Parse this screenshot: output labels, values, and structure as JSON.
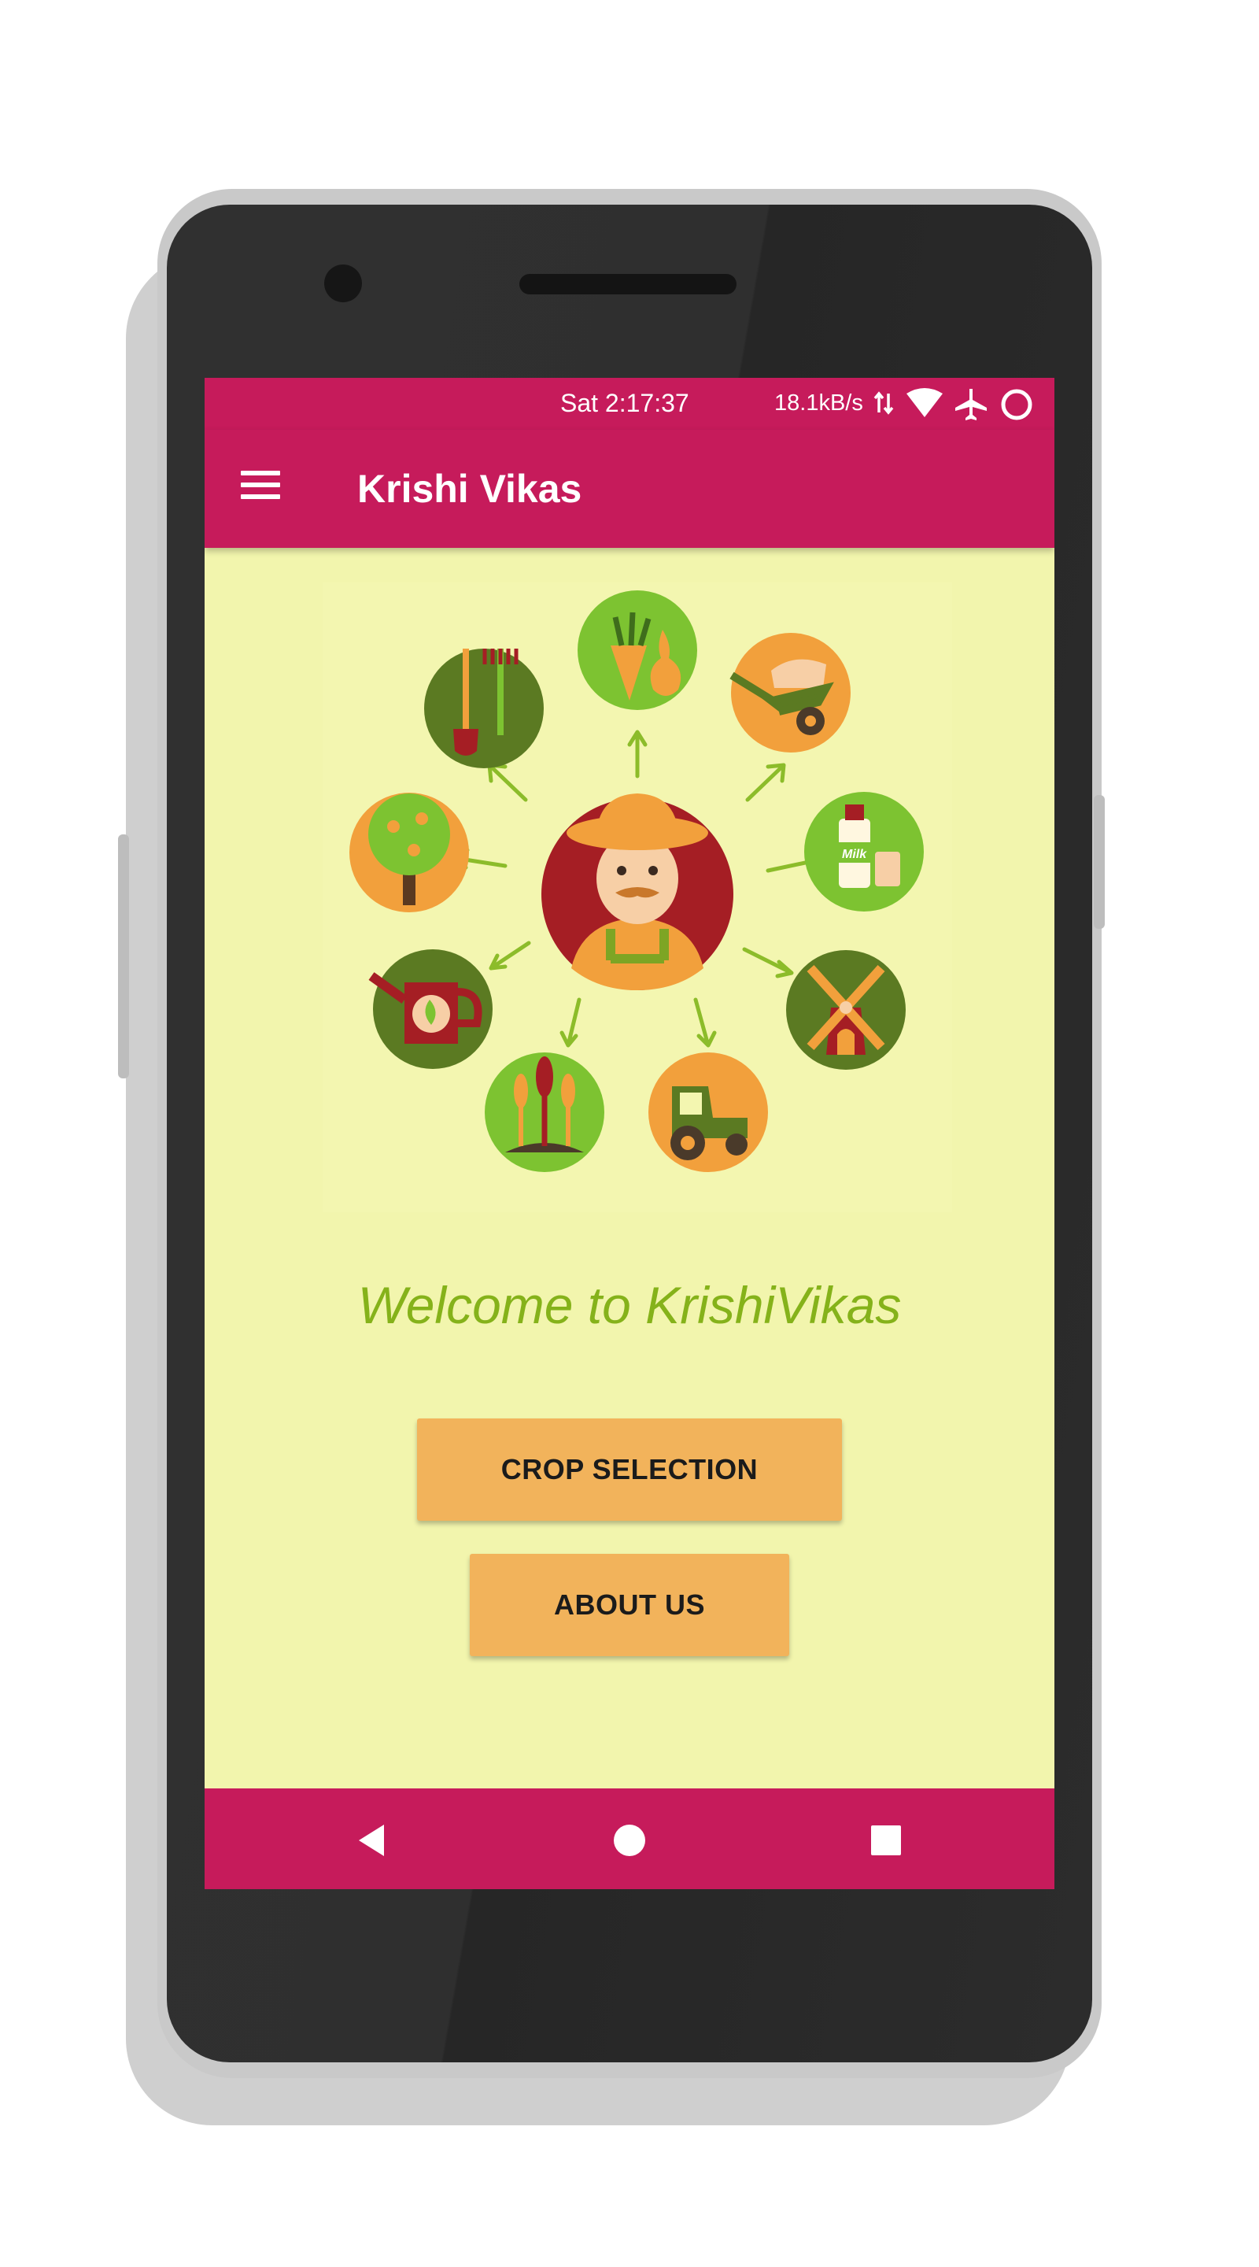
{
  "status_bar": {
    "time": "Sat 2:17:37",
    "net_speed": "18.1kB/s",
    "icons": [
      "data-arrows-icon",
      "wifi-icon",
      "airplane-icon",
      "circle-status-icon"
    ]
  },
  "app_bar": {
    "title": "Krishi Vikas",
    "menu_icon": "hamburger-menu-icon"
  },
  "hero": {
    "center": "farmer-icon",
    "items": [
      "garden-tools-icon",
      "vegetables-icon",
      "wheelbarrow-icon",
      "milk-icon",
      "windmill-icon",
      "tractor-icon",
      "wheat-icon",
      "watering-can-icon",
      "fruit-tree-icon"
    ],
    "milk_label": "Milk"
  },
  "main": {
    "welcome_text": "Welcome to KrishiVikas",
    "crop_button": "CROP SELECTION",
    "about_button": "ABOUT US"
  },
  "nav_bar": {
    "icons": [
      "back-icon",
      "home-icon",
      "recents-icon"
    ]
  },
  "colors": {
    "primary": "#c61b5b",
    "background": "#f2f5ad",
    "accent_text": "#85b21a",
    "button": "#f2b35b"
  }
}
